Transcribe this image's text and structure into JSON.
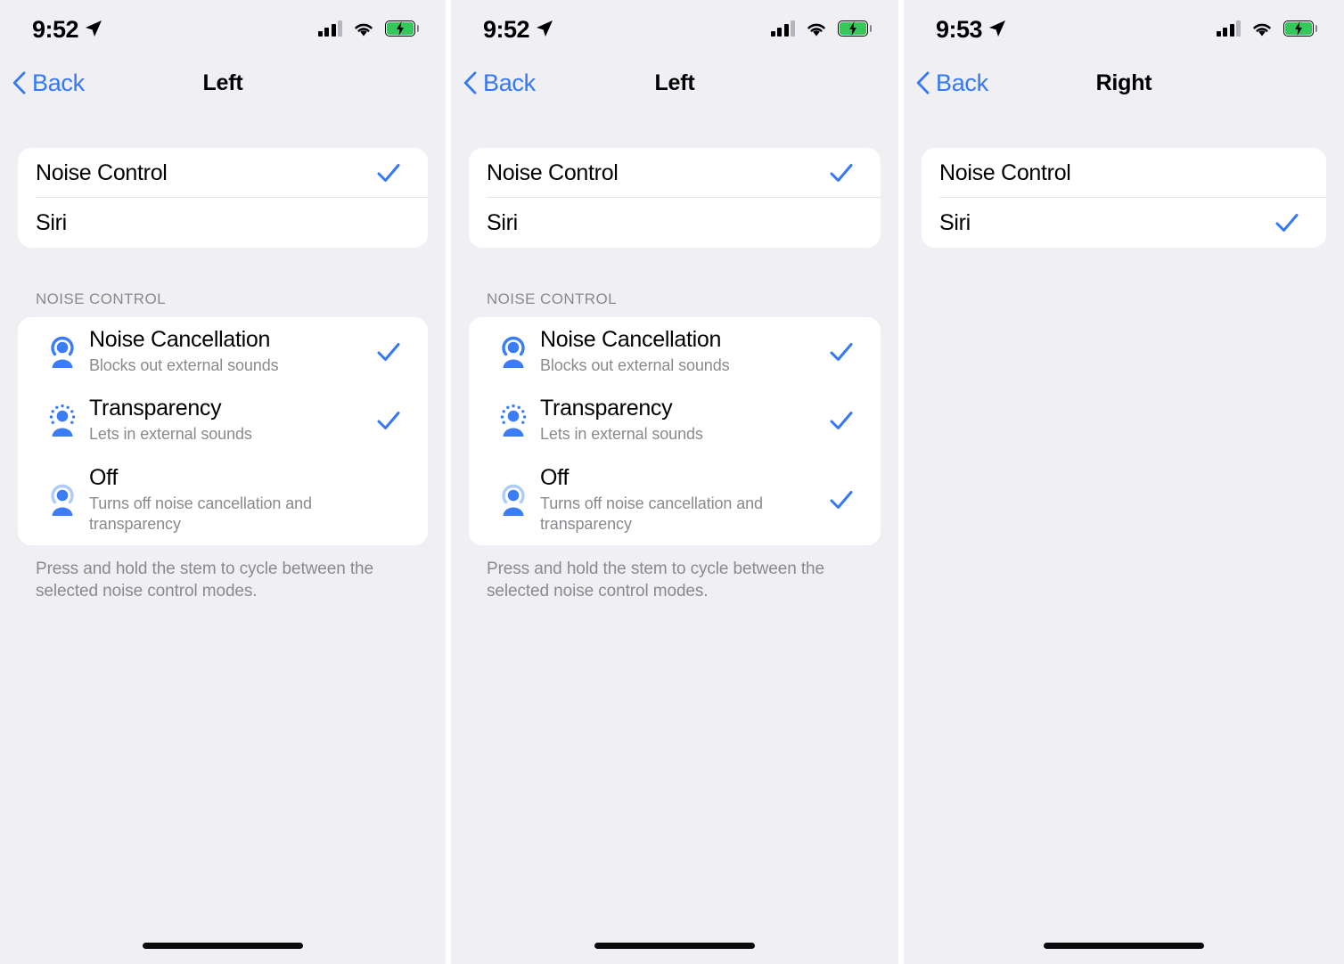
{
  "panels": [
    {
      "status": {
        "time": "9:52",
        "location_icon": "location-arrow-icon",
        "cellular_icon": "cellular-bars-icon",
        "wifi_icon": "wifi-icon",
        "battery_icon": "battery-charging-icon"
      },
      "nav": {
        "back_label": "Back",
        "back_icon": "chevron-left-icon",
        "title": "Left"
      },
      "press_hold_rows": [
        {
          "label": "Noise Control",
          "checked": true
        },
        {
          "label": "Siri",
          "checked": false
        }
      ],
      "noise_section": {
        "header": "NOISE CONTROL",
        "options": [
          {
            "title": "Noise Cancellation",
            "subtitle": "Blocks out external sounds",
            "icon": "noise-cancellation-icon",
            "checked": true
          },
          {
            "title": "Transparency",
            "subtitle": "Lets in external sounds",
            "icon": "transparency-icon",
            "checked": true
          },
          {
            "title": "Off",
            "subtitle": "Turns off noise cancellation and transparency",
            "icon": "noise-off-icon",
            "checked": false
          }
        ],
        "footnote": "Press and hold the stem to cycle between the selected noise control modes."
      }
    },
    {
      "status": {
        "time": "9:52",
        "location_icon": "location-arrow-icon",
        "cellular_icon": "cellular-bars-icon",
        "wifi_icon": "wifi-icon",
        "battery_icon": "battery-charging-icon"
      },
      "nav": {
        "back_label": "Back",
        "back_icon": "chevron-left-icon",
        "title": "Left"
      },
      "press_hold_rows": [
        {
          "label": "Noise Control",
          "checked": true
        },
        {
          "label": "Siri",
          "checked": false
        }
      ],
      "noise_section": {
        "header": "NOISE CONTROL",
        "options": [
          {
            "title": "Noise Cancellation",
            "subtitle": "Blocks out external sounds",
            "icon": "noise-cancellation-icon",
            "checked": true
          },
          {
            "title": "Transparency",
            "subtitle": "Lets in external sounds",
            "icon": "transparency-icon",
            "checked": true
          },
          {
            "title": "Off",
            "subtitle": "Turns off noise cancellation and transparency",
            "icon": "noise-off-icon",
            "checked": true
          }
        ],
        "footnote": "Press and hold the stem to cycle between the selected noise control modes."
      }
    },
    {
      "status": {
        "time": "9:53",
        "location_icon": "location-arrow-icon",
        "cellular_icon": "cellular-bars-icon",
        "wifi_icon": "wifi-icon",
        "battery_icon": "battery-charging-icon"
      },
      "nav": {
        "back_label": "Back",
        "back_icon": "chevron-left-icon",
        "title": "Right"
      },
      "press_hold_rows": [
        {
          "label": "Noise Control",
          "checked": false
        },
        {
          "label": "Siri",
          "checked": true
        }
      ],
      "noise_section": null
    }
  ],
  "colors": {
    "background": "#F0EFF4",
    "card": "#FFFFFF",
    "accent_blue": "#3478F6",
    "icon_blue": "#3B7DF7",
    "icon_blue_faded": "#AFCBFA",
    "secondary_text": "#8A8A8E",
    "separator": "#E4E4E8",
    "battery_green": "#35C759"
  }
}
